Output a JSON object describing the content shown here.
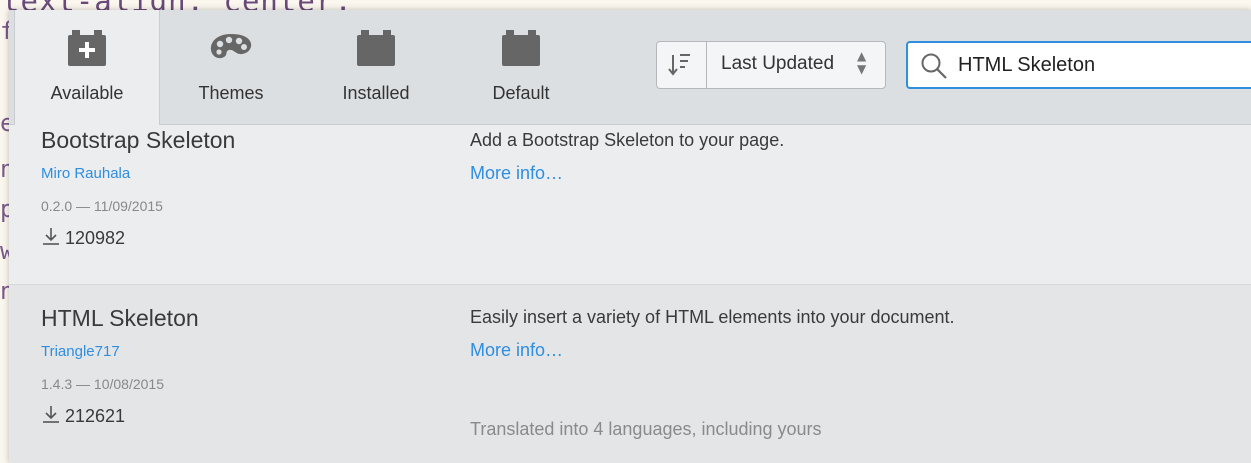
{
  "editor": {
    "code_line": "text-align: center;",
    "gutter_chars": [
      "f",
      "e",
      "n",
      "p",
      "w",
      "n"
    ]
  },
  "tabs": [
    {
      "label": "Available",
      "icon": "plus-box-icon",
      "active": true
    },
    {
      "label": "Themes",
      "icon": "palette-icon",
      "active": false
    },
    {
      "label": "Installed",
      "icon": "puzzle-block-icon",
      "active": false
    },
    {
      "label": "Default",
      "icon": "puzzle-block-icon",
      "active": false
    }
  ],
  "sort": {
    "label": "Last Updated",
    "icon": "sort-order-icon"
  },
  "search": {
    "value": "HTML Skeleton",
    "icon": "search-icon"
  },
  "extensions": [
    {
      "title": "Bootstrap Skeleton",
      "author": "Miro Rauhala",
      "version_date": "0.2.0 — 11/09/2015",
      "downloads": "120982",
      "description": "Add a Bootstrap Skeleton to your page.",
      "more_info": "More info…"
    },
    {
      "title": "HTML Skeleton",
      "author": "Triangle717",
      "version_date": "1.4.3 — 10/08/2015",
      "downloads": "212621",
      "description": "Easily insert a variety of HTML elements into your document.",
      "more_info": "More info…",
      "translated": "Translated into 4 languages, including yours"
    }
  ],
  "colors": {
    "accent": "#2f8ee0",
    "toolbar": "#dcdfe2",
    "panel": "#ebedef"
  }
}
